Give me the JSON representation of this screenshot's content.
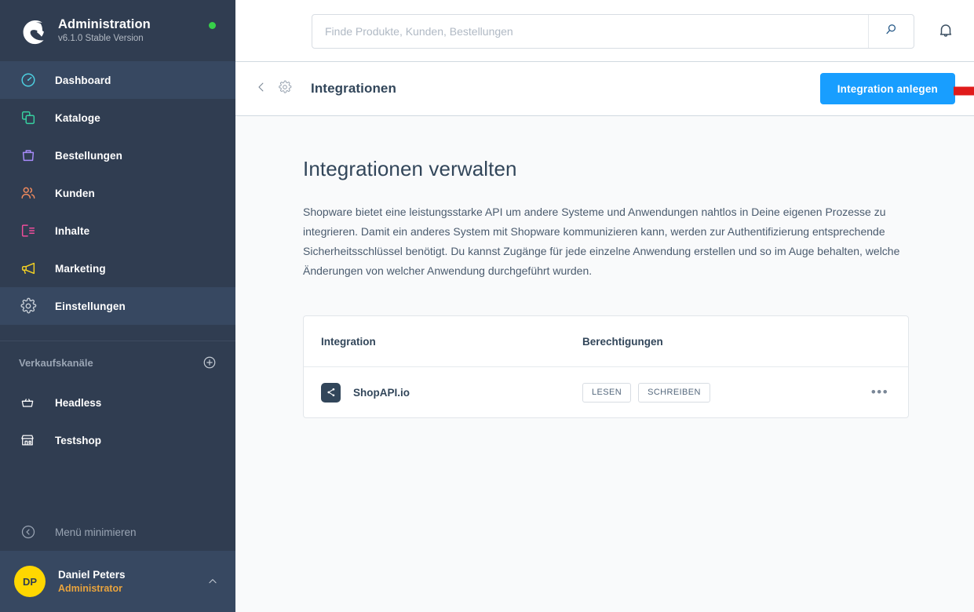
{
  "sidebar": {
    "logo_icon": "shopware-logo-icon",
    "title": "Administration",
    "version": "v6.1.0 Stable Version",
    "status_dot_color": "#37d049",
    "nav_items": [
      {
        "label": "Dashboard",
        "icon": "dashboard-gauge-icon",
        "color": "#4dd0e1",
        "active": true
      },
      {
        "label": "Kataloge",
        "icon": "catalog-copy-icon",
        "color": "#37d1a0",
        "active": false
      },
      {
        "label": "Bestellungen",
        "icon": "orders-bag-icon",
        "color": "#a78bfa",
        "active": false
      },
      {
        "label": "Kunden",
        "icon": "customers-users-icon",
        "color": "#f08a5d",
        "active": false
      },
      {
        "label": "Inhalte",
        "icon": "content-layout-icon",
        "color": "#ee4d9b",
        "active": false
      },
      {
        "label": "Marketing",
        "icon": "marketing-megaphone-icon",
        "color": "#f2d024",
        "active": false
      },
      {
        "label": "Einstellungen",
        "icon": "settings-gear-icon",
        "color": "#c9d0d8",
        "active": true
      }
    ],
    "group": {
      "label": "Verkaufskanäle",
      "add_icon": "plus-circle-icon"
    },
    "channels": [
      {
        "label": "Headless",
        "icon": "basket-icon"
      },
      {
        "label": "Testshop",
        "icon": "storefront-icon"
      }
    ],
    "minimize": {
      "label": "Menü minimieren",
      "icon": "collapse-left-icon"
    },
    "user": {
      "initials": "DP",
      "name": "Daniel Peters",
      "role": "Administrator",
      "caret_icon": "chevron-up-icon",
      "avatar_color": "#ffd700"
    }
  },
  "topbar": {
    "search_placeholder": "Finde Produkte, Kunden, Bestellungen",
    "search_value": "",
    "search_icon": "search-icon",
    "bell_icon": "notification-bell-icon"
  },
  "page_header": {
    "back_icon": "chevron-left-icon",
    "gear_icon": "settings-gear-icon",
    "title": "Integrationen",
    "primary_button": "Integration anlegen",
    "primary_color": "#189eff"
  },
  "annotation": {
    "arrow_icon": "red-arrow-right-icon",
    "box_color": "#e01b1b"
  },
  "content": {
    "title": "Integrationen verwalten",
    "description": "Shopware bietet eine leistungsstarke API um andere Systeme und Anwendungen nahtlos in Deine eigenen Prozesse zu integrieren. Damit ein anderes System mit Shopware kommunizieren kann, werden zur Authentifizierung entsprechende Sicherheitsschlüssel benötigt. Du kannst Zugänge für jede einzelne Anwendung erstellen und so im Auge behalten, welche Änderungen von welcher Anwendung durchgeführt wurden.",
    "table": {
      "columns": [
        "Integration",
        "Berechtigungen"
      ],
      "rows": [
        {
          "icon": "share-nodes-icon",
          "name": "ShopAPI.io",
          "permissions": [
            "LESEN",
            "SCHREIBEN"
          ],
          "menu_icon": "ellipsis-icon",
          "menu_label": "•••"
        }
      ]
    }
  }
}
